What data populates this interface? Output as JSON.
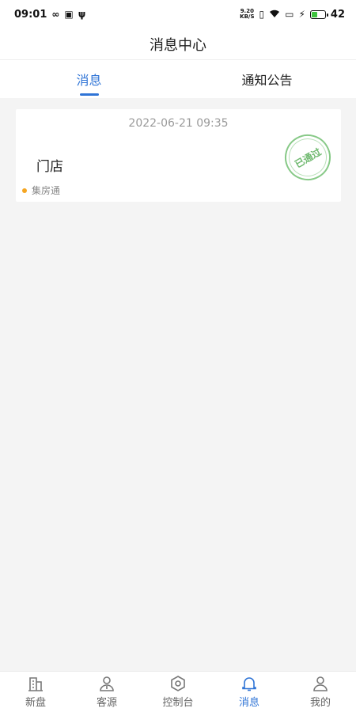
{
  "status_bar": {
    "time": "09:01",
    "net_speed_value": "9.20",
    "net_speed_unit": "KB/S",
    "battery_level": "42",
    "battery_fill_fraction": 0.42
  },
  "header": {
    "title": "消息中心"
  },
  "tabs": [
    {
      "label": "消息",
      "active": true
    },
    {
      "label": "通知公告",
      "active": false
    }
  ],
  "messages": [
    {
      "time": "2022-06-21 09:35",
      "title": "门店",
      "source": "集房通",
      "stamp": "已通过",
      "stamp_color": "#87c987",
      "dot_color": "#f5a623"
    }
  ],
  "bottom_nav": [
    {
      "label": "新盘",
      "icon": "building-icon",
      "active": false
    },
    {
      "label": "客源",
      "icon": "person-icon",
      "active": false
    },
    {
      "label": "控制台",
      "icon": "hexagon-icon",
      "active": false
    },
    {
      "label": "消息",
      "icon": "bell-icon",
      "active": true
    },
    {
      "label": "我的",
      "icon": "user-icon",
      "active": false
    }
  ],
  "colors": {
    "accent": "#2f74d6",
    "background": "#f4f4f4"
  }
}
